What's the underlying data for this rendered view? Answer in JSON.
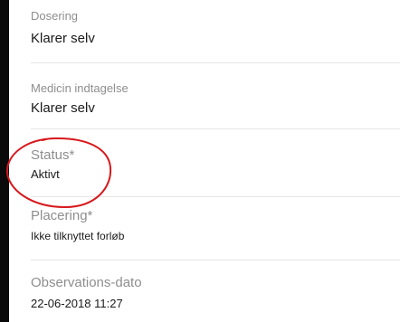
{
  "fields": [
    {
      "label": "Dosering",
      "value": "Klarer selv"
    },
    {
      "label": "Medicin indtagelse",
      "value": "Klarer selv"
    },
    {
      "label": "Status*",
      "value": "Aktivt"
    },
    {
      "label": "Placering*",
      "value": "Ikke tilknyttet forløb"
    },
    {
      "label": "Observations-dato",
      "value": "22-06-2018 11:27"
    }
  ],
  "annotation": {
    "color": "#d7191c",
    "highlighted_field": "Status*"
  }
}
